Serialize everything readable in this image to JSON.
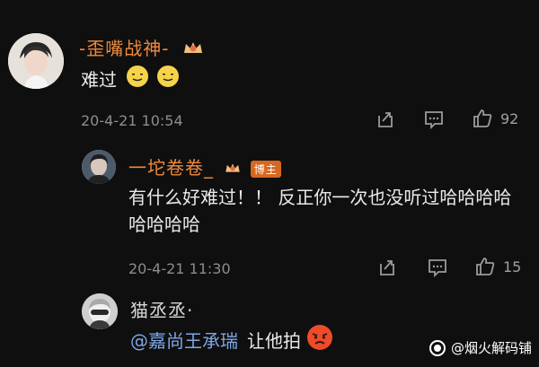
{
  "comments": [
    {
      "username": "-歪嘴战神-",
      "text": "难过",
      "emoji": [
        "smile-emoji",
        "smile-emoji"
      ],
      "timestamp": "20-4-21 10:54",
      "likes": "92"
    },
    {
      "username": "一坨卷卷_",
      "badge": "博主",
      "text": "有什么好难过！！ 反正你一次也没听过哈哈哈哈哈哈哈哈",
      "timestamp": "20-4-21 11:30",
      "likes": "15"
    },
    {
      "username": "猫丞丞·",
      "mention": "@嘉尚王承瑞",
      "text": "让他拍",
      "emoji": [
        "angry-emoji"
      ]
    }
  ],
  "watermark": "@烟火解码铺",
  "icons": {
    "share": "share-icon",
    "comment": "comment-icon",
    "like": "thumbs-up-icon",
    "crown": "crown-icon"
  },
  "colors": {
    "background": "#0f0f0f",
    "username": "#f08a3c",
    "mention": "#7ea7e6",
    "meta": "#8d8d8d"
  }
}
